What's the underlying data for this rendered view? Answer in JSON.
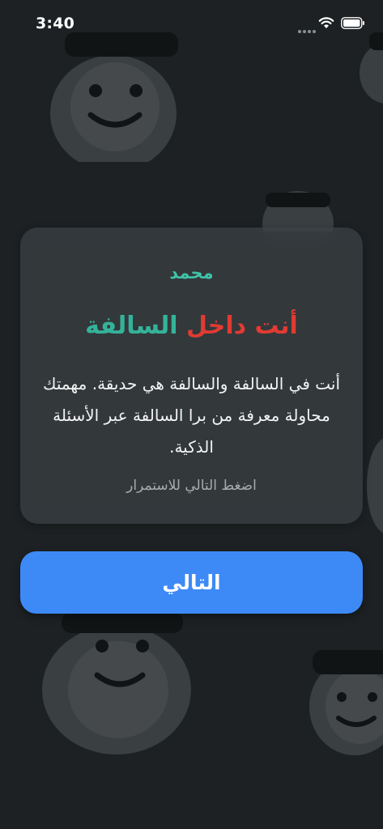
{
  "status_bar": {
    "time": "3:40",
    "icons": [
      "signal-dots-icon",
      "wifi-icon",
      "battery-icon"
    ]
  },
  "background": {
    "icon": "saudi-face-icon"
  },
  "card": {
    "player_name": "محمد",
    "role_title_part1": "أنت داخل ",
    "role_title_part2": "السالفة",
    "description": "أنت في السالفة والسالفة هي حديقة. مهمتك محاولة معرفة من برا السالفة عبر الأسئلة الذكية.",
    "hint": "اضغط التالي للاستمرار"
  },
  "next_button": {
    "label": "التالي"
  },
  "colors": {
    "background": "#1d2123",
    "name_teal": "#3fc3a8",
    "title_red": "#e03b32",
    "title_teal": "#34b39a",
    "button_blue": "#3d8af7"
  }
}
